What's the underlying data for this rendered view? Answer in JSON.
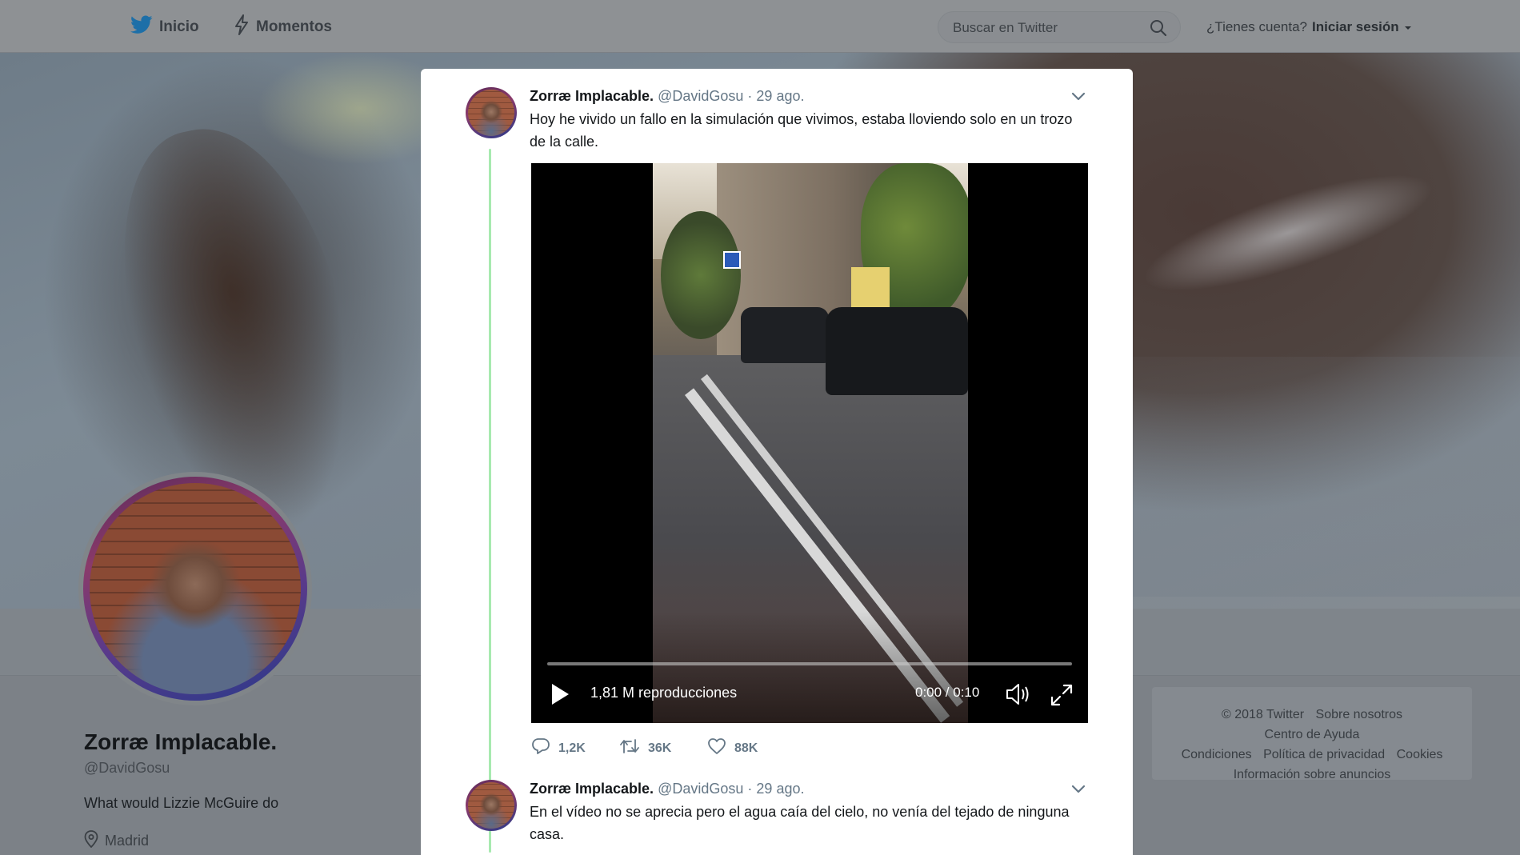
{
  "nav": {
    "home_label": "Inicio",
    "moments_label": "Momentos",
    "search_placeholder": "Buscar en Twitter",
    "login_prompt": "¿Tienes cuenta?",
    "login_label": "Iniciar sesión"
  },
  "profile": {
    "name": "Zorræ Implacable.",
    "handle": "@DavidGosu",
    "bio": "What would Lizzie McGuire do",
    "location": "Madrid"
  },
  "footer": {
    "links": [
      "© 2018 Twitter",
      "Sobre nosotros",
      "Centro de Ayuda",
      "Condiciones",
      "Política de privacidad",
      "Cookies",
      "Información sobre anuncios"
    ]
  },
  "tweets": [
    {
      "name": "Zorræ Implacable.",
      "handle": "@DavidGosu",
      "date": "· 29 ago.",
      "text": "Hoy he vivido un fallo en la simulación que vivimos, estaba lloviendo solo en un trozo de la calle.",
      "video": {
        "views": "1,81 M reproducciones",
        "time": "0:00 / 0:10",
        "progress": 0
      },
      "replies": "1,2K",
      "retweets": "36K",
      "likes": "88K"
    },
    {
      "name": "Zorræ Implacable.",
      "handle": "@DavidGosu",
      "date": "· 29 ago.",
      "text": "En el vídeo no se aprecia pero el agua caía del cielo, no venía del tejado de ninguna casa."
    }
  ],
  "colors": {
    "thread_line": "#a7eab0",
    "twitter_blue": "#1da1f2"
  }
}
